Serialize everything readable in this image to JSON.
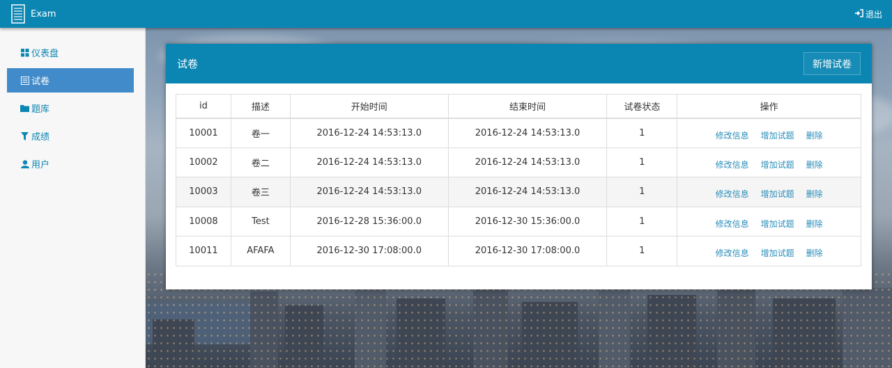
{
  "header": {
    "app_name": "Exam",
    "logout_label": "退出",
    "accent": "#0b86b3"
  },
  "sidebar": {
    "items": [
      {
        "label": "仪表盘",
        "icon": "dashboard-icon",
        "active": false
      },
      {
        "label": "试卷",
        "icon": "document-icon",
        "active": true
      },
      {
        "label": "题库",
        "icon": "folder-icon",
        "active": false
      },
      {
        "label": "成绩",
        "icon": "filter-icon",
        "active": false
      },
      {
        "label": "用户",
        "icon": "user-icon",
        "active": false
      }
    ]
  },
  "panel": {
    "title": "试卷",
    "add_button": "新增试卷"
  },
  "table": {
    "columns": [
      "id",
      "描述",
      "开始时间",
      "结束时间",
      "试卷状态",
      "操作"
    ],
    "rows": [
      {
        "id": "10001",
        "desc": "卷一",
        "start": "2016-12-24 14:53:13.0",
        "end": "2016-12-24 14:53:13.0",
        "status": "1"
      },
      {
        "id": "10002",
        "desc": "卷二",
        "start": "2016-12-24 14:53:13.0",
        "end": "2016-12-24 14:53:13.0",
        "status": "1"
      },
      {
        "id": "10003",
        "desc": "卷三",
        "start": "2016-12-24 14:53:13.0",
        "end": "2016-12-24 14:53:13.0",
        "status": "1"
      },
      {
        "id": "10008",
        "desc": "Test",
        "start": "2016-12-28 15:36:00.0",
        "end": "2016-12-30 15:36:00.0",
        "status": "1"
      },
      {
        "id": "10011",
        "desc": "AFAFA",
        "start": "2016-12-30 17:08:00.0",
        "end": "2016-12-30 17:08:00.0",
        "status": "1"
      }
    ],
    "actions": {
      "edit": "修改信息",
      "add_questions": "增加试题",
      "delete": "删除"
    }
  }
}
